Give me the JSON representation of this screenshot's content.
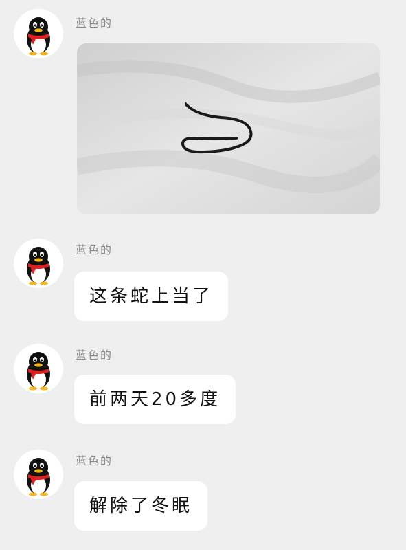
{
  "messages": [
    {
      "sender": "蓝色的",
      "type": "image",
      "image_icon": "snake-on-snow-photo"
    },
    {
      "sender": "蓝色的",
      "type": "text",
      "text": "这条蛇上当了"
    },
    {
      "sender": "蓝色的",
      "type": "text",
      "text": "前两天20多度"
    },
    {
      "sender": "蓝色的",
      "type": "text",
      "text": "解除了冬眠"
    }
  ],
  "avatar_icon": "qq-penguin-icon",
  "colors": {
    "background": "#efefef",
    "bubble": "#ffffff",
    "sender_name": "#8a8a8a",
    "penguin_scarf": "#e02020"
  }
}
